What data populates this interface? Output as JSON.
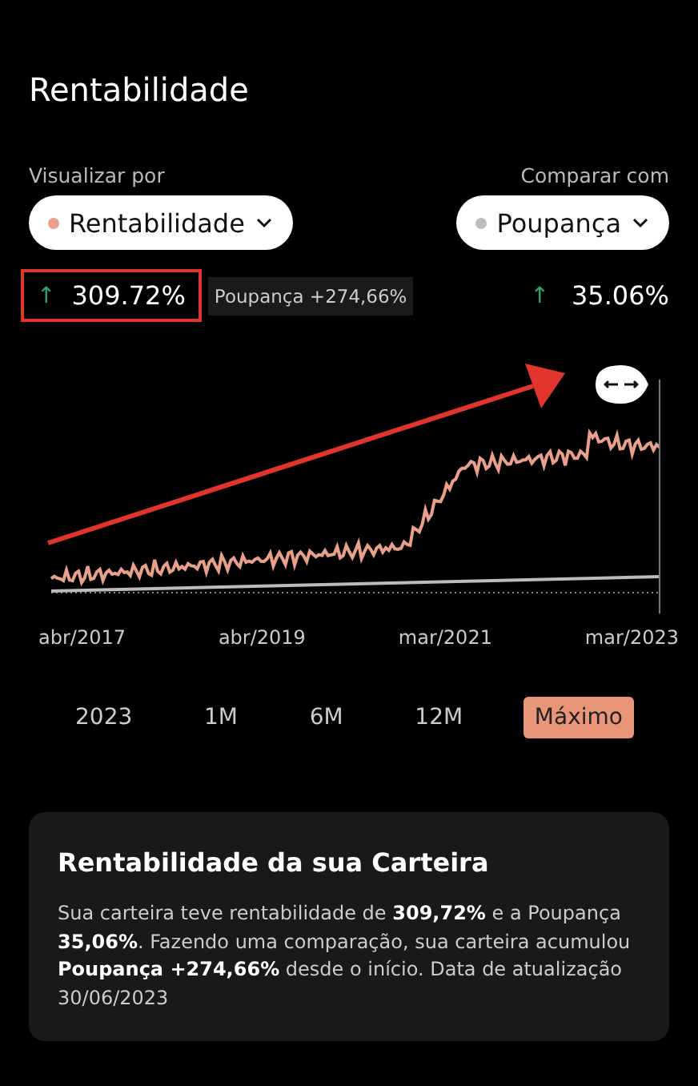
{
  "title": "Rentabilidade",
  "view_by": {
    "label": "Visualizar por",
    "value": "Rentabilidade",
    "color": "#e8a08a"
  },
  "compare_with": {
    "label": "Comparar com",
    "value": "Poupança",
    "color": "#bdbdbd"
  },
  "portfolio_return": {
    "arrow": "↑",
    "value": "309.72%",
    "comparison": "Poupança +274,66%"
  },
  "benchmark_return": {
    "arrow": "↑",
    "value": "35.06%"
  },
  "chart": {
    "x_labels": [
      "abr/2017",
      "abr/2019",
      "mar/2021",
      "mar/2023"
    ]
  },
  "periods": [
    {
      "label": "2023",
      "selected": false
    },
    {
      "label": "1M",
      "selected": false
    },
    {
      "label": "6M",
      "selected": false
    },
    {
      "label": "12M",
      "selected": false
    },
    {
      "label": "Máximo",
      "selected": true
    }
  ],
  "summary": {
    "title": "Rentabilidade da sua Carteira",
    "text": "Sua carteira teve rentabilidade de **309,72%** e a Poupança **35,06%**. Fazendo uma comparação, sua carteira acumulou **Poupança +274,66%** desde o início. Data de atualização 30/06/2023"
  }
}
